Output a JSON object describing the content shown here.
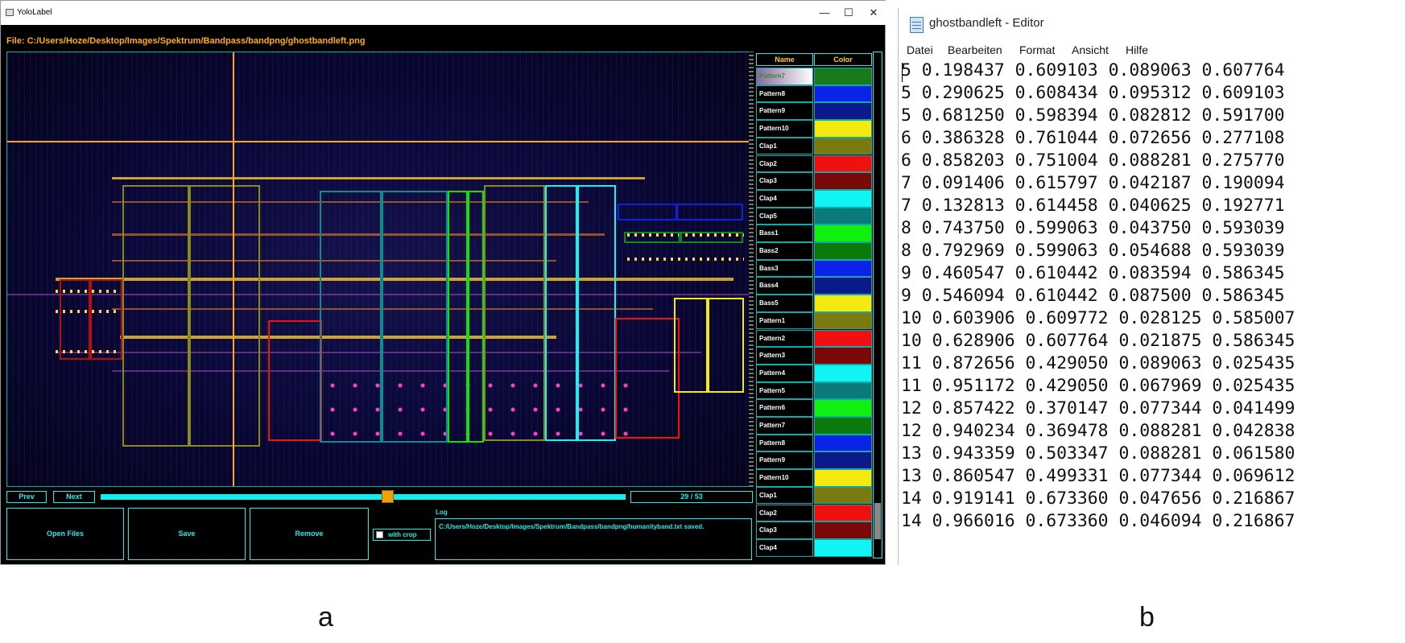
{
  "yolo": {
    "title": "YoloLabel",
    "window_buttons": [
      "—",
      "☐",
      "✕"
    ],
    "file_label": "File: C:/Users/Hoze/Desktop/Images/Spektrum/Bandpass/bandpng/ghostbandleft.png",
    "table": {
      "headers": {
        "name": "Name",
        "color": "Color"
      },
      "rows": [
        {
          "name": "Pattern7",
          "color": "#1a7a1a",
          "selected": true
        },
        {
          "name": "Pattern8",
          "color": "#0b23e6"
        },
        {
          "name": "Pattern9",
          "color": "#0a1a8a"
        },
        {
          "name": "Pattern10",
          "color": "#f4ea10"
        },
        {
          "name": "Clap1",
          "color": "#7a7a10"
        },
        {
          "name": "Clap2",
          "color": "#f01010"
        },
        {
          "name": "Clap3",
          "color": "#7a0808"
        },
        {
          "name": "Clap4",
          "color": "#10f4f4"
        },
        {
          "name": "Clap5",
          "color": "#0a7a7a"
        },
        {
          "name": "Bass1",
          "color": "#10f010"
        },
        {
          "name": "Bass2",
          "color": "#0a7a0a"
        },
        {
          "name": "Bass3",
          "color": "#0b23e6"
        },
        {
          "name": "Bass4",
          "color": "#0a1a8a"
        },
        {
          "name": "Bass5",
          "color": "#f4ea10"
        },
        {
          "name": "Pattern1",
          "color": "#7a7a10"
        },
        {
          "name": "Pattern2",
          "color": "#f01010"
        },
        {
          "name": "Pattern3",
          "color": "#7a0808"
        },
        {
          "name": "Pattern4",
          "color": "#10f4f4"
        },
        {
          "name": "Pattern5",
          "color": "#0a7a7a"
        },
        {
          "name": "Pattern6",
          "color": "#10f010"
        },
        {
          "name": "Pattern7",
          "color": "#0a7a0a"
        },
        {
          "name": "Pattern8",
          "color": "#0b23e6"
        },
        {
          "name": "Pattern9",
          "color": "#0a1a8a"
        },
        {
          "name": "Pattern10",
          "color": "#f4ea10"
        },
        {
          "name": "Clap1",
          "color": "#7a7a10"
        },
        {
          "name": "Clap2",
          "color": "#f01010"
        },
        {
          "name": "Clap3",
          "color": "#7a0808"
        },
        {
          "name": "Clap4",
          "color": "#10f4f4"
        }
      ]
    },
    "controls": {
      "prev": "Prev",
      "next": "Next",
      "page": "29 / 53",
      "slider_fraction": 0.55,
      "open_files": "Open Files",
      "save": "Save",
      "remove": "Remove",
      "with_crop": "with crop",
      "log_label": "Log",
      "log_text": "C:/Users/Hoze/Desktop/Images/Spektrum/Bandpass/bandpng/humanityband.txt saved."
    }
  },
  "editor": {
    "title": "ghostbandleft - Editor",
    "menu": [
      "Datei",
      "Bearbeiten",
      "Format",
      "Ansicht",
      "Hilfe"
    ],
    "lines": [
      "5 0.198437 0.609103 0.089063 0.607764",
      "5 0.290625 0.608434 0.095312 0.609103",
      "5 0.681250 0.598394 0.082812 0.591700",
      "6 0.386328 0.761044 0.072656 0.277108",
      "6 0.858203 0.751004 0.088281 0.275770",
      "7 0.091406 0.615797 0.042187 0.190094",
      "7 0.132813 0.614458 0.040625 0.192771",
      "8 0.743750 0.599063 0.043750 0.593039",
      "8 0.792969 0.599063 0.054688 0.593039",
      "9 0.460547 0.610442 0.083594 0.586345",
      "9 0.546094 0.610442 0.087500 0.586345",
      "10 0.603906 0.609772 0.028125 0.585007",
      "10 0.628906 0.607764 0.021875 0.586345",
      "11 0.872656 0.429050 0.089063 0.025435",
      "11 0.951172 0.429050 0.067969 0.025435",
      "12 0.857422 0.370147 0.077344 0.041499",
      "12 0.940234 0.369478 0.088281 0.042838",
      "13 0.943359 0.503347 0.088281 0.061580",
      "13 0.860547 0.499331 0.077344 0.069612",
      "14 0.919141 0.673360 0.047656 0.216867",
      "14 0.966016 0.673360 0.046094 0.216867"
    ]
  },
  "captions": {
    "a": "a",
    "b": "b"
  }
}
